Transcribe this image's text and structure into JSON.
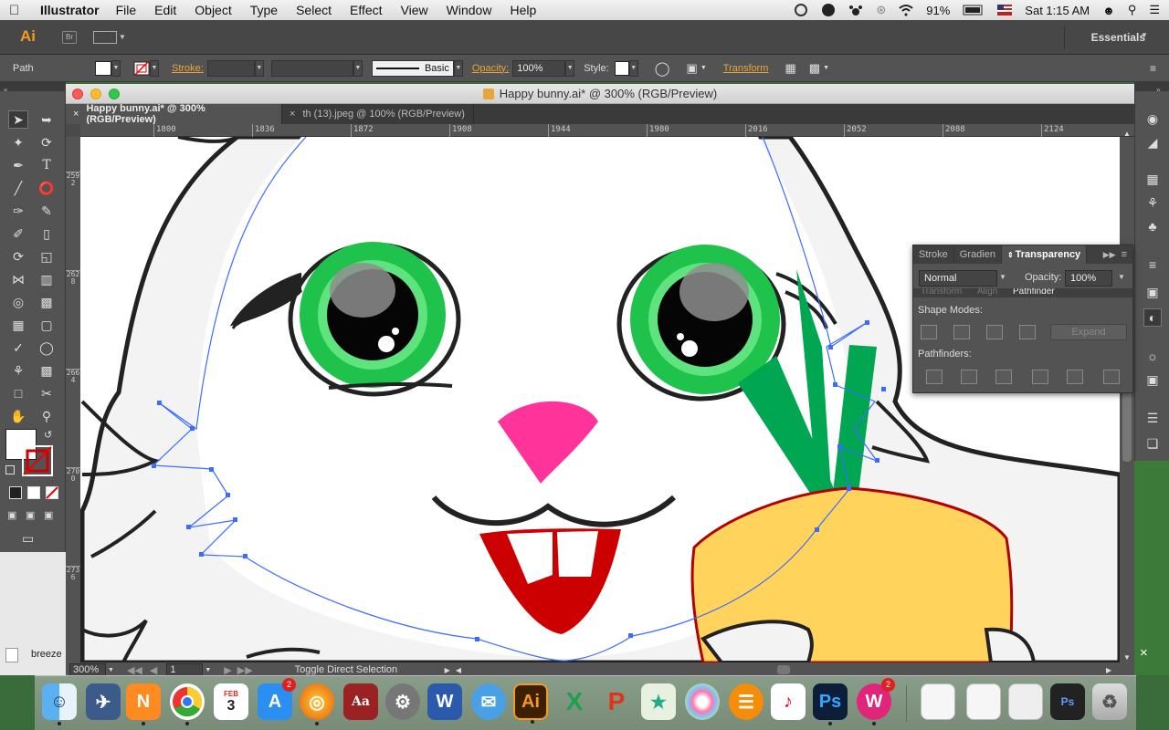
{
  "menubar": {
    "app_name": "Illustrator",
    "items": [
      "File",
      "Edit",
      "Object",
      "Type",
      "Select",
      "Effect",
      "View",
      "Window",
      "Help"
    ],
    "battery": "91%",
    "clock": "Sat 1:15 AM"
  },
  "appbar": {
    "logo": "Ai",
    "bridge": "Br",
    "workspace": "Essentials"
  },
  "controlbar": {
    "selection_type": "Path",
    "stroke_label": "Stroke:",
    "brush_label": "Basic",
    "opacity_label": "Opacity:",
    "opacity_value": "100%",
    "style_label": "Style:",
    "transform_label": "Transform"
  },
  "document": {
    "title": "Happy bunny.ai* @ 300% (RGB/Preview)",
    "tabs": [
      {
        "label": "Happy bunny.ai* @ 300% (RGB/Preview)",
        "active": true
      },
      {
        "label": "th (13).jpeg @ 100% (RGB/Preview)",
        "active": false
      }
    ],
    "ruler_h": [
      "1800",
      "1836",
      "1872",
      "1908",
      "1944",
      "1980",
      "2016",
      "2052",
      "2088",
      "2124"
    ],
    "ruler_v": [
      "2592",
      "2628",
      "2664",
      "2700",
      "2736"
    ],
    "zoom": "300%",
    "page": "1",
    "status_text": "Toggle Direct Selection"
  },
  "transparency_panel": {
    "tabs": [
      "Stroke",
      "Gradien",
      "Transparency"
    ],
    "blend_mode": "Normal",
    "opacity_label": "Opacity:",
    "opacity_value": "100%",
    "hidden_tabs": [
      "Transform",
      "Align",
      "Pathfinder"
    ],
    "shape_modes_label": "Shape Modes:",
    "expand_label": "Expand",
    "pathfinders_label": "Pathfinders:"
  },
  "desktop": {
    "behind_item": "breeze"
  },
  "dock": {
    "calendar_month": "FEB",
    "calendar_day": "3",
    "appstore_badge": "2",
    "wps_badge": "2"
  },
  "colors": {
    "panel_bg": "#535353",
    "accent_orange": "#e8a53a",
    "eye_green": "#1fc24a",
    "nose_pink": "#ff3399",
    "mouth_red": "#cc0000",
    "carrot": "#ffd35c",
    "carrot_outline": "#b30000",
    "leaf_green": "#00a651",
    "path_blue": "#3b6cff"
  }
}
